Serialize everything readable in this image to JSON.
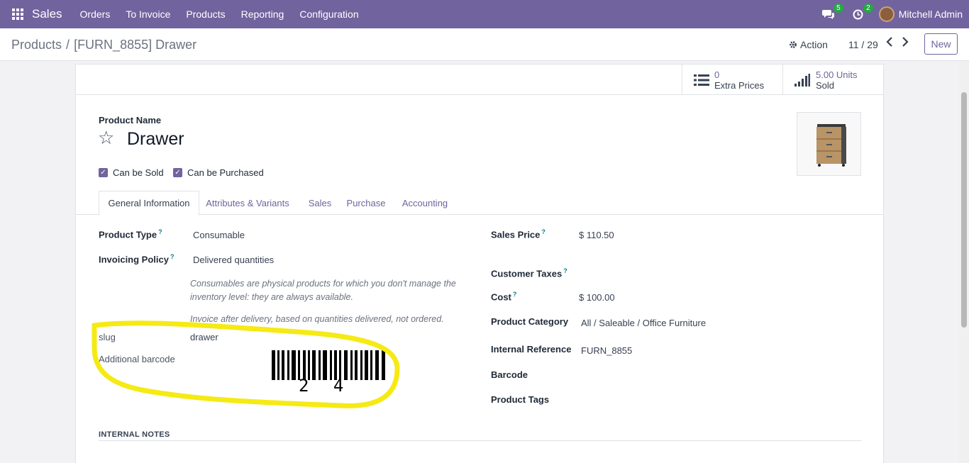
{
  "navbar": {
    "app_name": "Sales",
    "menu": [
      "Orders",
      "To Invoice",
      "Products",
      "Reporting",
      "Configuration"
    ],
    "messages_count": "5",
    "activities_count": "2",
    "user": "Mitchell Admin",
    "bg_color": "#71639e"
  },
  "control": {
    "breadcrumb_parent": "Products",
    "breadcrumb_sep": "/",
    "breadcrumb_current": "[FURN_8855] Drawer",
    "action_label": "Action",
    "pager": "11 / 29",
    "new_label": "New"
  },
  "smart_buttons": {
    "extra_prices_value": "0",
    "extra_prices_label": "Extra Prices",
    "sold_value": "5.00 Units",
    "sold_label": "Sold"
  },
  "product": {
    "name_label": "Product Name",
    "name": "Drawer",
    "can_be_sold": "Can be Sold",
    "can_be_purchased": "Can be Purchased"
  },
  "tabs": [
    "General Information",
    "Attributes & Variants",
    "Sales",
    "Purchase",
    "Accounting"
  ],
  "general": {
    "product_type_label": "Product Type",
    "product_type": "Consumable",
    "invoicing_policy_label": "Invoicing Policy",
    "invoicing_policy": "Delivered quantities",
    "help_consumable": "Consumables are physical products for which you don't manage the inventory level: they are always available.",
    "help_invoice": "Invoice after delivery, based on quantities delivered, not ordered.",
    "slug_label": "slug",
    "slug": "drawer",
    "additional_barcode_label": "Additional barcode",
    "barcode_text": "2 4",
    "sales_price_label": "Sales Price",
    "sales_price": "$ 110.50",
    "customer_taxes_label": "Customer Taxes",
    "cost_label": "Cost",
    "cost": "$ 100.00",
    "product_category_label": "Product Category",
    "product_category": "All / Saleable / Office Furniture",
    "internal_reference_label": "Internal Reference",
    "internal_reference": "FURN_8855",
    "barcode_label": "Barcode",
    "product_tags_label": "Product Tags",
    "help_mark": "?"
  },
  "internal_notes_title": "INTERNAL NOTES"
}
